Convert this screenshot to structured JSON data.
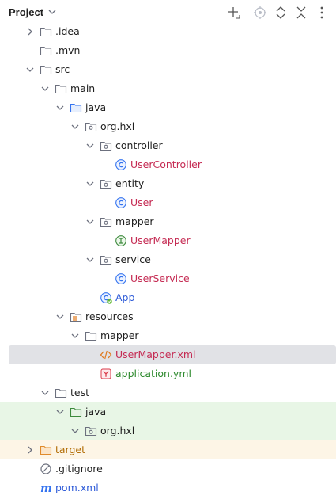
{
  "header": {
    "title": "Project"
  },
  "tree": [
    {
      "label": ".idea",
      "icon": "folder-icon",
      "expander": "collapsed"
    },
    {
      "label": ".mvn",
      "icon": "folder-icon",
      "expander": "none"
    },
    {
      "label": "src",
      "icon": "folder-icon",
      "expander": "expanded"
    },
    {
      "label": "main",
      "icon": "folder-icon",
      "expander": "expanded"
    },
    {
      "label": "java",
      "icon": "source-folder-icon",
      "expander": "expanded"
    },
    {
      "label": "org.hxl",
      "icon": "package-icon",
      "expander": "expanded"
    },
    {
      "label": "controller",
      "icon": "package-icon",
      "expander": "expanded"
    },
    {
      "label": "UserController",
      "icon": "class-icon",
      "expander": "none",
      "color": "red"
    },
    {
      "label": "entity",
      "icon": "package-icon",
      "expander": "expanded"
    },
    {
      "label": "User",
      "icon": "class-icon",
      "expander": "none",
      "color": "red"
    },
    {
      "label": "mapper",
      "icon": "package-icon",
      "expander": "expanded"
    },
    {
      "label": "UserMapper",
      "icon": "interface-icon",
      "expander": "none",
      "color": "red"
    },
    {
      "label": "service",
      "icon": "package-icon",
      "expander": "expanded"
    },
    {
      "label": "UserService",
      "icon": "class-icon",
      "expander": "none",
      "color": "red"
    },
    {
      "label": "App",
      "icon": "spring-app-icon",
      "expander": "none",
      "color": "blue"
    },
    {
      "label": "resources",
      "icon": "resources-folder-icon",
      "expander": "expanded"
    },
    {
      "label": "mapper",
      "icon": "folder-icon",
      "expander": "expanded"
    },
    {
      "label": "UserMapper.xml",
      "icon": "xml-icon",
      "expander": "none",
      "color": "red",
      "selected": true
    },
    {
      "label": "application.yml",
      "icon": "yaml-icon",
      "expander": "none",
      "color": "green"
    },
    {
      "label": "test",
      "icon": "folder-icon",
      "expander": "expanded"
    },
    {
      "label": "java",
      "icon": "test-folder-icon",
      "expander": "expanded",
      "highlight": "green"
    },
    {
      "label": "org.hxl",
      "icon": "package-icon",
      "expander": "expanded",
      "highlight": "green"
    },
    {
      "label": "target",
      "icon": "excluded-folder-icon",
      "expander": "collapsed",
      "color": "orange",
      "highlight": "orange"
    },
    {
      "label": ".gitignore",
      "icon": "ignore-file-icon",
      "expander": "none"
    },
    {
      "label": "pom.xml",
      "icon": "maven-icon",
      "expander": "none",
      "color": "blue"
    }
  ],
  "colors": {
    "red": "#c52b53",
    "blue": "#2e5bd8",
    "green": "#2e8a2e",
    "orange": "#b06a00",
    "selection": "#e1e2e6",
    "test_highlight": "#e8f6e6",
    "excluded_highlight": "#fdf5e6"
  }
}
